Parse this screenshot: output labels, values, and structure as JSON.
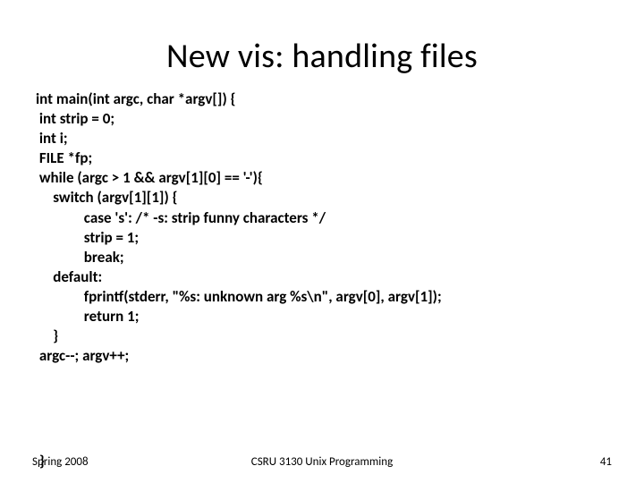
{
  "title": "New vis: handling files",
  "code": {
    "l0": "int main(int argc, char *argv[]) {",
    "l1": " int strip = 0;",
    "l2": " int i;",
    "l3": " FILE *fp;",
    "l4": " while (argc > 1 && argv[1][0] == '-'){",
    "l5": "     switch (argv[1][1]) {",
    "l6": "              case 's': /* -s: strip funny characters */",
    "l7": "              strip = 1;",
    "l8": "              break;",
    "l9": "     default:",
    "l10": "              fprintf(stderr, \"%s: unknown arg %s\\n\", argv[0], argv[1]);",
    "l11": "              return 1;",
    "l12": "     }",
    "l13": " argc--; argv++;"
  },
  "brace": "}",
  "footer": {
    "left": "Spring 2008",
    "center": "CSRU 3130 Unix Programming",
    "right": "41"
  }
}
